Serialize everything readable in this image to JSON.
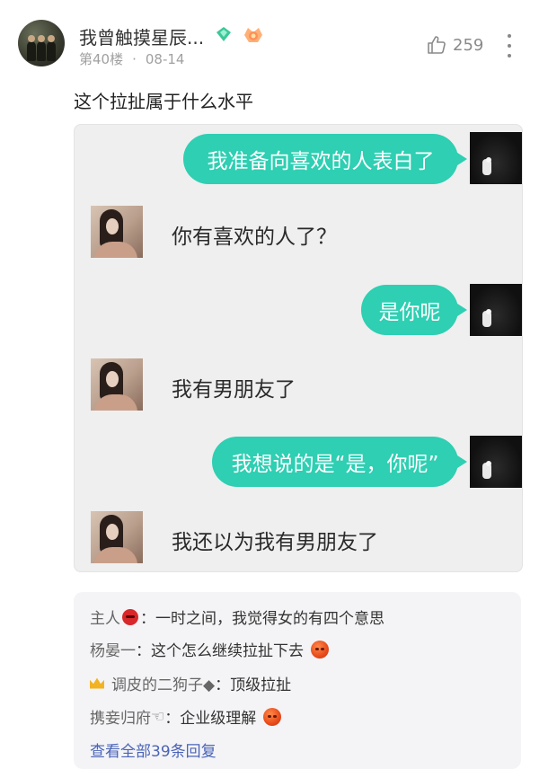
{
  "post": {
    "username": "我曾触摸星辰...",
    "floor": "第40楼",
    "date": "08-14",
    "like_count": "259",
    "text": "这个拉扯属于什么水平"
  },
  "chat": {
    "messages": [
      {
        "side": "right",
        "text": "我准备向喜欢的人表白了"
      },
      {
        "side": "left",
        "text": "你有喜欢的人了？"
      },
      {
        "side": "right",
        "text": "是你呢"
      },
      {
        "side": "left",
        "text": "我有男朋友了"
      },
      {
        "side": "right",
        "text": "我想说的是“是，你呢”"
      },
      {
        "side": "left",
        "text": "我还以为我有男朋友了"
      }
    ]
  },
  "comments": {
    "items": [
      {
        "name": "主人",
        "text": "：一时之间，我觉得女的有四个意思"
      },
      {
        "name": "杨晏一",
        "text": "：这个怎么继续拉扯下去"
      },
      {
        "name": "调皮的二狗子◆",
        "text": "：顶级拉扯"
      },
      {
        "name": "携妾归府",
        "text": "：企业级理解"
      }
    ],
    "view_all": "查看全部39条回复"
  },
  "icons": {
    "thumb_up": "thumb-up-icon",
    "more": "more-vertical-icon",
    "diamond_badge": "diamond-badge-icon",
    "level_badge": "level-badge-icon",
    "devil_emoji": "devil-emoji-icon",
    "angry_emoji": "angry-emoji-icon",
    "crown": "crown-icon",
    "pointing_hand": "pointing-hand-icon"
  },
  "colors": {
    "bubble": "#2ecfb2",
    "link": "#4a63b8",
    "meta": "#a0a0a0"
  }
}
